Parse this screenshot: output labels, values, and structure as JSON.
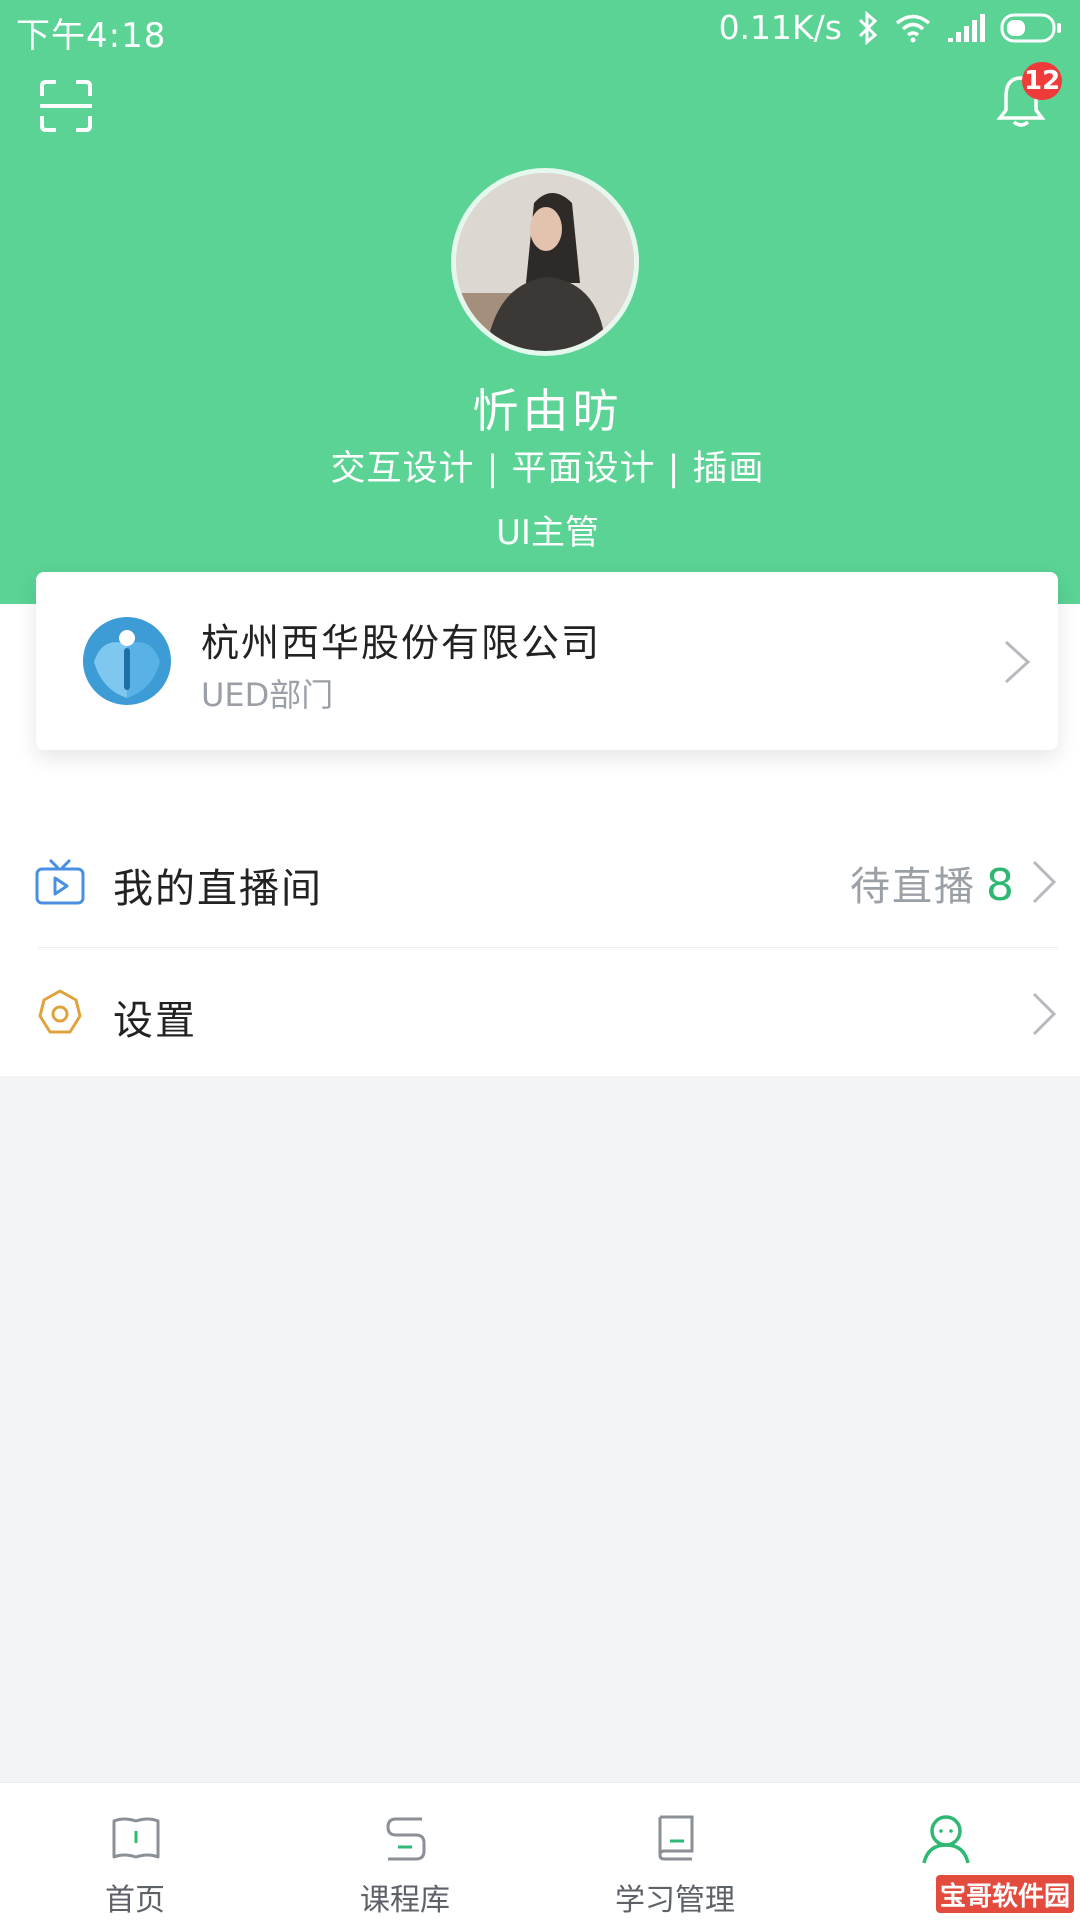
{
  "status_bar": {
    "time": "下午4:18",
    "network_speed": "0.11K/s",
    "icons": [
      "bluetooth-icon",
      "wifi-icon",
      "signal-icon",
      "battery-icon"
    ]
  },
  "header": {
    "scan_icon": "scan-icon",
    "notification_icon": "bell-icon",
    "notification_count": "12",
    "background_color": "#5ad394"
  },
  "profile": {
    "name": "忻由昉",
    "tags": "交互设计 | 平面设计 | 插画",
    "role": "UI主管"
  },
  "company": {
    "name": "杭州西华股份有限公司",
    "department": "UED部门"
  },
  "menu": {
    "live_room": {
      "label": "我的直播间",
      "status_text": "待直播",
      "count": "8",
      "icon": "tv-play-icon"
    },
    "settings": {
      "label": "设置",
      "icon": "gear-icon"
    }
  },
  "bottom_nav": {
    "items": [
      {
        "label": "首页",
        "icon": "book-icon"
      },
      {
        "label": "课程库",
        "icon": "course-library-icon"
      },
      {
        "label": "学习管理",
        "icon": "study-manage-icon"
      },
      {
        "label": "",
        "icon": "person-icon"
      }
    ],
    "accent_color": "#2fb872"
  },
  "watermark": "宝哥软件园"
}
